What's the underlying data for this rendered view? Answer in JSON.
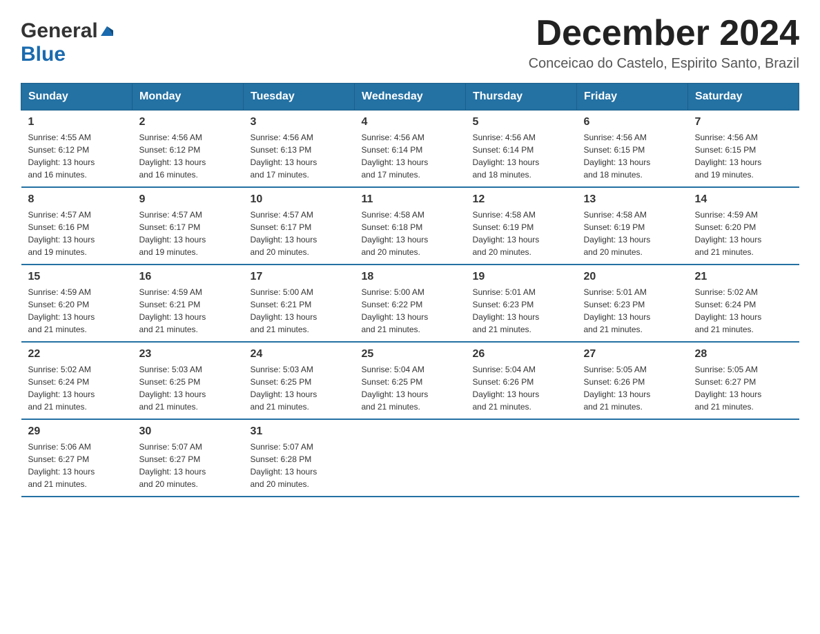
{
  "header": {
    "logo_general": "General",
    "logo_blue": "Blue",
    "month_title": "December 2024",
    "location": "Conceicao do Castelo, Espirito Santo, Brazil"
  },
  "weekdays": [
    "Sunday",
    "Monday",
    "Tuesday",
    "Wednesday",
    "Thursday",
    "Friday",
    "Saturday"
  ],
  "weeks": [
    [
      {
        "day": "1",
        "sunrise": "4:55 AM",
        "sunset": "6:12 PM",
        "daylight": "13 hours and 16 minutes."
      },
      {
        "day": "2",
        "sunrise": "4:56 AM",
        "sunset": "6:12 PM",
        "daylight": "13 hours and 16 minutes."
      },
      {
        "day": "3",
        "sunrise": "4:56 AM",
        "sunset": "6:13 PM",
        "daylight": "13 hours and 17 minutes."
      },
      {
        "day": "4",
        "sunrise": "4:56 AM",
        "sunset": "6:14 PM",
        "daylight": "13 hours and 17 minutes."
      },
      {
        "day": "5",
        "sunrise": "4:56 AM",
        "sunset": "6:14 PM",
        "daylight": "13 hours and 18 minutes."
      },
      {
        "day": "6",
        "sunrise": "4:56 AM",
        "sunset": "6:15 PM",
        "daylight": "13 hours and 18 minutes."
      },
      {
        "day": "7",
        "sunrise": "4:56 AM",
        "sunset": "6:15 PM",
        "daylight": "13 hours and 19 minutes."
      }
    ],
    [
      {
        "day": "8",
        "sunrise": "4:57 AM",
        "sunset": "6:16 PM",
        "daylight": "13 hours and 19 minutes."
      },
      {
        "day": "9",
        "sunrise": "4:57 AM",
        "sunset": "6:17 PM",
        "daylight": "13 hours and 19 minutes."
      },
      {
        "day": "10",
        "sunrise": "4:57 AM",
        "sunset": "6:17 PM",
        "daylight": "13 hours and 20 minutes."
      },
      {
        "day": "11",
        "sunrise": "4:58 AM",
        "sunset": "6:18 PM",
        "daylight": "13 hours and 20 minutes."
      },
      {
        "day": "12",
        "sunrise": "4:58 AM",
        "sunset": "6:19 PM",
        "daylight": "13 hours and 20 minutes."
      },
      {
        "day": "13",
        "sunrise": "4:58 AM",
        "sunset": "6:19 PM",
        "daylight": "13 hours and 20 minutes."
      },
      {
        "day": "14",
        "sunrise": "4:59 AM",
        "sunset": "6:20 PM",
        "daylight": "13 hours and 21 minutes."
      }
    ],
    [
      {
        "day": "15",
        "sunrise": "4:59 AM",
        "sunset": "6:20 PM",
        "daylight": "13 hours and 21 minutes."
      },
      {
        "day": "16",
        "sunrise": "4:59 AM",
        "sunset": "6:21 PM",
        "daylight": "13 hours and 21 minutes."
      },
      {
        "day": "17",
        "sunrise": "5:00 AM",
        "sunset": "6:21 PM",
        "daylight": "13 hours and 21 minutes."
      },
      {
        "day": "18",
        "sunrise": "5:00 AM",
        "sunset": "6:22 PM",
        "daylight": "13 hours and 21 minutes."
      },
      {
        "day": "19",
        "sunrise": "5:01 AM",
        "sunset": "6:23 PM",
        "daylight": "13 hours and 21 minutes."
      },
      {
        "day": "20",
        "sunrise": "5:01 AM",
        "sunset": "6:23 PM",
        "daylight": "13 hours and 21 minutes."
      },
      {
        "day": "21",
        "sunrise": "5:02 AM",
        "sunset": "6:24 PM",
        "daylight": "13 hours and 21 minutes."
      }
    ],
    [
      {
        "day": "22",
        "sunrise": "5:02 AM",
        "sunset": "6:24 PM",
        "daylight": "13 hours and 21 minutes."
      },
      {
        "day": "23",
        "sunrise": "5:03 AM",
        "sunset": "6:25 PM",
        "daylight": "13 hours and 21 minutes."
      },
      {
        "day": "24",
        "sunrise": "5:03 AM",
        "sunset": "6:25 PM",
        "daylight": "13 hours and 21 minutes."
      },
      {
        "day": "25",
        "sunrise": "5:04 AM",
        "sunset": "6:25 PM",
        "daylight": "13 hours and 21 minutes."
      },
      {
        "day": "26",
        "sunrise": "5:04 AM",
        "sunset": "6:26 PM",
        "daylight": "13 hours and 21 minutes."
      },
      {
        "day": "27",
        "sunrise": "5:05 AM",
        "sunset": "6:26 PM",
        "daylight": "13 hours and 21 minutes."
      },
      {
        "day": "28",
        "sunrise": "5:05 AM",
        "sunset": "6:27 PM",
        "daylight": "13 hours and 21 minutes."
      }
    ],
    [
      {
        "day": "29",
        "sunrise": "5:06 AM",
        "sunset": "6:27 PM",
        "daylight": "13 hours and 21 minutes."
      },
      {
        "day": "30",
        "sunrise": "5:07 AM",
        "sunset": "6:27 PM",
        "daylight": "13 hours and 20 minutes."
      },
      {
        "day": "31",
        "sunrise": "5:07 AM",
        "sunset": "6:28 PM",
        "daylight": "13 hours and 20 minutes."
      },
      null,
      null,
      null,
      null
    ]
  ],
  "labels": {
    "sunrise": "Sunrise:",
    "sunset": "Sunset:",
    "daylight": "Daylight:"
  }
}
